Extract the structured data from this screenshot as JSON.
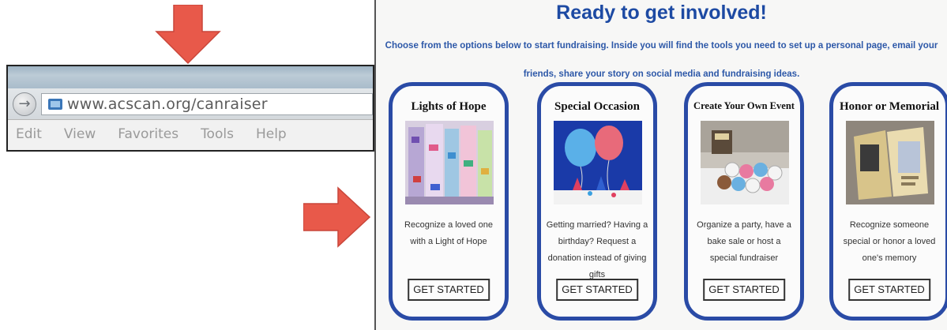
{
  "browser": {
    "url": "www.acscan.org/canraiser",
    "menu": [
      "Edit",
      "View",
      "Favorites",
      "Tools",
      "Help"
    ]
  },
  "page": {
    "title": "Ready to get involved!",
    "subtitle": "Choose from the options below to start fundraising. Inside you will find the tools you need to set up a personal page, email your friends, share your story on social media and fundraising ideas.",
    "cards": [
      {
        "title": "Lights of Hope",
        "image": "lights-of-hope-photo",
        "description": "Recognize a loved one with a Light of Hope",
        "button": "GET STARTED"
      },
      {
        "title": "Special Occasion",
        "image": "balloons-photo",
        "description": "Getting married? Having a birthday? Request a donation instead of giving gifts",
        "button": "GET STARTED"
      },
      {
        "title": "Create Your Own Event",
        "image": "cupcakes-photo",
        "description": "Organize a party, have a bake sale or host a special fundraiser",
        "button": "GET STARTED"
      },
      {
        "title": "Honor or Memorial",
        "image": "memorial-cards-photo",
        "description": "Recognize someone special or honor a loved one's memory",
        "button": "GET STARTED"
      }
    ]
  },
  "colors": {
    "accent_blue": "#2a4ba6",
    "title_blue": "#1d4aa3",
    "arrow_red": "#e8594a"
  },
  "icons": {
    "down_arrow": "red-down-arrow-icon",
    "right_arrow": "red-right-arrow-icon",
    "back": "back-arrow-icon",
    "page": "page-icon"
  }
}
